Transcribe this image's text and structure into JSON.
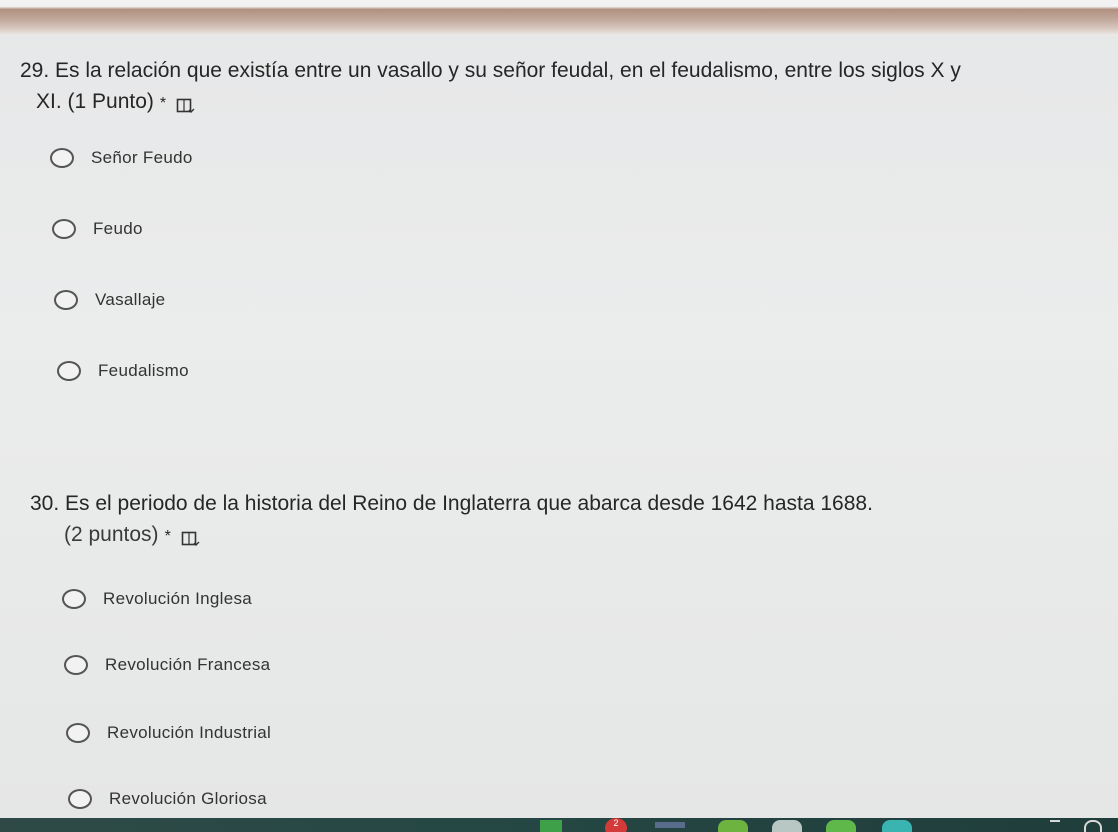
{
  "questions": [
    {
      "title_line1": "29. Es la relación que existía entre un vasallo y su señor feudal, en el feudalismo, entre los siglos X y",
      "title_line2": "XI. (1 Punto)",
      "required_mark": "*",
      "icon": "immersive-reader-icon",
      "options": [
        "Señor Feudo",
        "Feudo",
        "Vasallaje",
        "Feudalismo"
      ]
    },
    {
      "title_line1": "30. Es el periodo de la historia del Reino de Inglaterra que abarca desde 1642 hasta 1688.",
      "title_line2": "(2 puntos)",
      "required_mark": "*",
      "icon": "immersive-reader-icon",
      "options": [
        "Revolución Inglesa",
        "Revolución Francesa",
        "Revolución Industrial",
        "Revolución Gloriosa"
      ]
    }
  ],
  "taskbar": {
    "icons": [
      "calculator-icon",
      "notification-badge-icon",
      "app-icon",
      "green-arc-icon",
      "chrome-like-icon",
      "edge-like-icon",
      "teal-arc-icon",
      "chevron-up-icon",
      "refresh-icon"
    ],
    "badge_count": "2"
  },
  "colors": {
    "text": "#262626",
    "radio_border": "#555555",
    "taskbar": "#2a4744"
  }
}
